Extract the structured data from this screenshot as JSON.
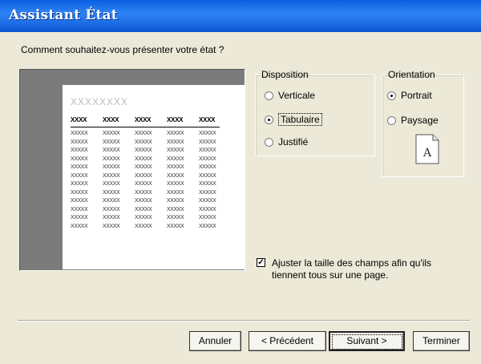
{
  "window": {
    "title": "Assistant État"
  },
  "question": "Comment souhaitez-vous présenter votre état ?",
  "preview": {
    "title_placeholder": "XXXXXXXX",
    "header_cells": [
      "XXXX",
      "XXXX",
      "XXXX",
      "XXXX",
      "XXXX"
    ],
    "row_cells": [
      "XXXXX",
      "XXXXX",
      "XXXXX",
      "XXXXX",
      "XXXXX"
    ],
    "row_count": 12
  },
  "disposition": {
    "legend": "Disposition",
    "options": [
      {
        "label": "Verticale",
        "selected": false
      },
      {
        "label": "Tabulaire",
        "selected": true
      },
      {
        "label": "Justifié",
        "selected": false
      }
    ]
  },
  "orientation": {
    "legend": "Orientation",
    "options": [
      {
        "label": "Portrait",
        "selected": true
      },
      {
        "label": "Paysage",
        "selected": false
      }
    ],
    "icon_letter": "A"
  },
  "adjust": {
    "checked": true,
    "label": "Ajuster la taille des champs afin qu'ils tiennent tous sur une page.",
    "check_glyph": "✓"
  },
  "buttons": {
    "cancel": "Annuler",
    "previous": "< Précédent",
    "next": "Suivant >",
    "finish": "Terminer"
  },
  "colors": {
    "title_bar": "#1f6fe6",
    "dialog_bg": "#ece9d8",
    "preview_bg": "#7b7b7b"
  }
}
